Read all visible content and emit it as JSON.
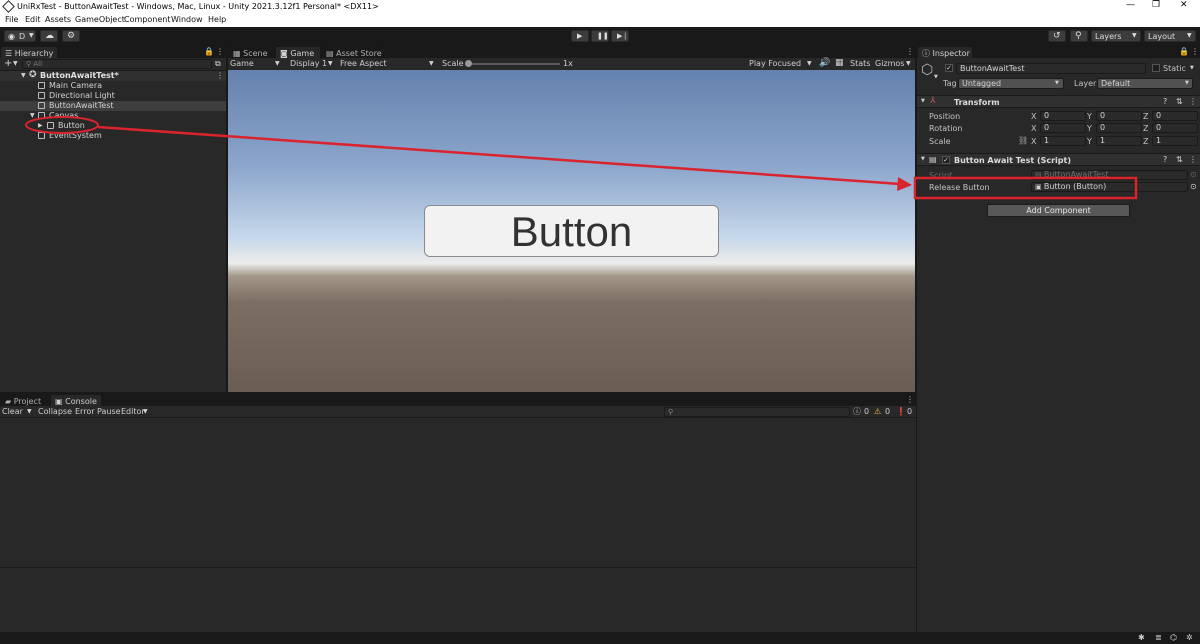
{
  "window": {
    "title": "UniRxTest - ButtonAwaitTest - Windows, Mac, Linux - Unity 2021.3.12f1 Personal* <DX11>",
    "controls": [
      "—",
      "❐",
      "✕"
    ]
  },
  "menu": [
    "File",
    "Edit",
    "Assets",
    "GameObject",
    "Component",
    "Window",
    "Help"
  ],
  "toolbar": {
    "account_label": "D",
    "layers_label": "Layers",
    "layout_label": "Layout"
  },
  "hierarchy": {
    "tab_label": "Hierarchy",
    "search_placeholder": "All",
    "items": [
      {
        "label": "ButtonAwaitTest*",
        "indent": 0,
        "bold": true
      },
      {
        "label": "Main Camera",
        "indent": 1
      },
      {
        "label": "Directional Light",
        "indent": 1
      },
      {
        "label": "ButtonAwaitTest",
        "indent": 1
      },
      {
        "label": "Canvas",
        "indent": 1
      },
      {
        "label": "Button",
        "indent": 2
      },
      {
        "label": "EventSystem",
        "indent": 1
      }
    ]
  },
  "center_tabs": [
    "Scene",
    "Game",
    "Asset Store"
  ],
  "game_toolbar": {
    "mode": "Game",
    "display": "Display 1",
    "aspect": "Free Aspect",
    "scale_label": "Scale",
    "scale_value": "1x",
    "play_focused": "Play Focused",
    "stats": "Stats",
    "gizmos": "Gizmos"
  },
  "game_button_text": "Button",
  "bottom_tabs": [
    "Project",
    "Console"
  ],
  "console_toolbar": {
    "clear": "Clear",
    "collapse": "Collapse",
    "error_pause": "Error Pause",
    "editor": "Editor",
    "count_warn": "0",
    "count_log": "0",
    "count_error": "0"
  },
  "inspector": {
    "tab_label": "Inspector",
    "object_name": "ButtonAwaitTest",
    "static_label": "Static",
    "tag_label": "Tag",
    "tag_value": "Untagged",
    "layer_label": "Layer",
    "layer_value": "Default",
    "transform": {
      "title": "Transform",
      "rows": [
        {
          "label": "Position",
          "x": "0",
          "y": "0",
          "z": "0"
        },
        {
          "label": "Rotation",
          "x": "0",
          "y": "0",
          "z": "0"
        },
        {
          "label": "Scale",
          "x": "1",
          "y": "1",
          "z": "1"
        }
      ],
      "axis": [
        "X",
        "Y",
        "Z"
      ]
    },
    "script_component": {
      "title": "Button Await Test (Script)",
      "script_label": "Script",
      "script_value": "ButtonAwaitTest",
      "field_label": "Release Button",
      "field_value": "Button (Button)"
    },
    "add_component": "Add Component"
  },
  "annotation_color": "#d9232d"
}
